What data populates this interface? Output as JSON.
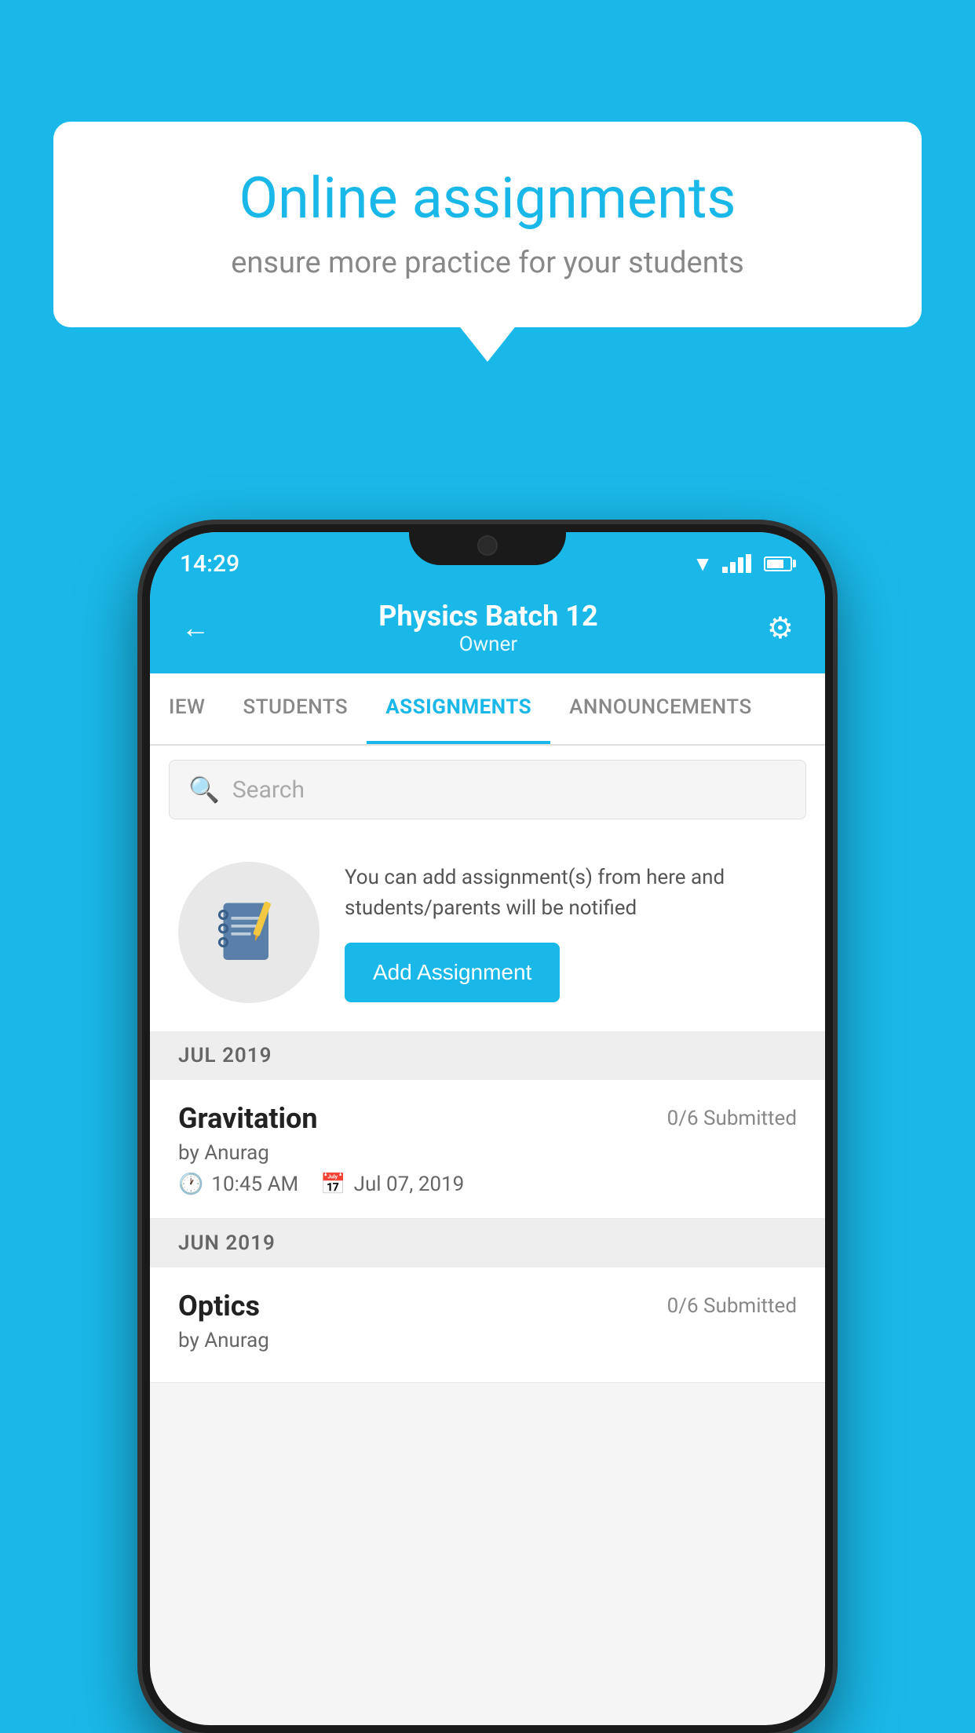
{
  "background_color": "#1ab8e8",
  "speech_bubble": {
    "title": "Online assignments",
    "subtitle": "ensure more practice for your students"
  },
  "status_bar": {
    "time": "14:29"
  },
  "header": {
    "title": "Physics Batch 12",
    "subtitle": "Owner",
    "back_label": "←",
    "settings_label": "⚙"
  },
  "tabs": [
    {
      "label": "IEW",
      "active": false
    },
    {
      "label": "STUDENTS",
      "active": false
    },
    {
      "label": "ASSIGNMENTS",
      "active": true
    },
    {
      "label": "ANNOUNCEMENTS",
      "active": false
    }
  ],
  "search": {
    "placeholder": "Search"
  },
  "info_card": {
    "text": "You can add assignment(s) from here and students/parents will be notified",
    "button_label": "Add Assignment"
  },
  "sections": [
    {
      "month": "JUL 2019",
      "assignments": [
        {
          "title": "Gravitation",
          "submitted": "0/6 Submitted",
          "author": "by Anurag",
          "time": "10:45 AM",
          "date": "Jul 07, 2019"
        }
      ]
    },
    {
      "month": "JUN 2019",
      "assignments": [
        {
          "title": "Optics",
          "submitted": "0/6 Submitted",
          "author": "by Anurag",
          "time": "",
          "date": ""
        }
      ]
    }
  ]
}
